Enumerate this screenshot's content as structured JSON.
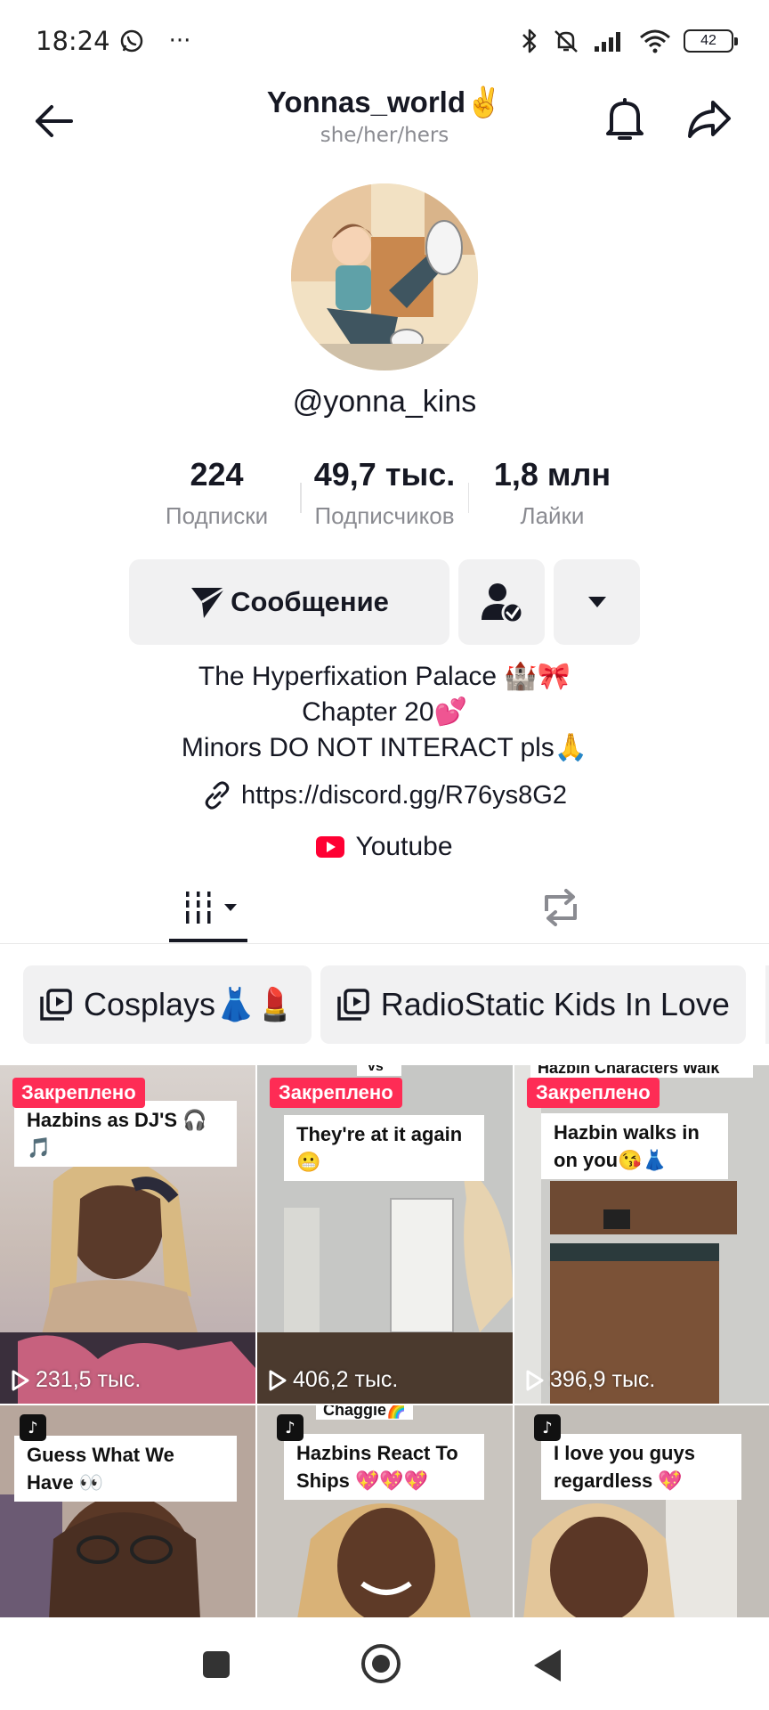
{
  "status_bar": {
    "time": "18:24",
    "more": "···",
    "battery": "42"
  },
  "header": {
    "title": "Yonnas_world✌️",
    "pronouns": "she/her/hers"
  },
  "profile": {
    "username": "@yonna_kins",
    "stats": [
      {
        "value": "224",
        "label": "Подписки"
      },
      {
        "value": "49,7 тыс.",
        "label": "Подписчиков"
      },
      {
        "value": "1,8 млн",
        "label": "Лайки"
      }
    ],
    "message_button": "Сообщение",
    "bio_lines": [
      "The Hyperfixation Palace 🏰🎀",
      "Chapter 20💕",
      "Minors DO NOT INTERACT pls🙏"
    ],
    "link": "https://discord.gg/R76ys8G2",
    "youtube": "Youtube"
  },
  "playlists": [
    {
      "label": "Cosplays👗💄"
    },
    {
      "label": "RadioStatic Kids In Love"
    }
  ],
  "videos": [
    {
      "pinned": "Закреплено",
      "caption": "Hazbins as DJ'S 🎧🎵",
      "views": "231,5 тыс.",
      "top_label": ""
    },
    {
      "pinned": "Закреплено",
      "caption": "They're at it again 😬",
      "views": "406,2 тыс.",
      "top_label": "vs"
    },
    {
      "pinned": "Закреплено",
      "caption": "Hazbin walks in on you😘👗",
      "views": "396,9 тыс.",
      "top_label": "Hazbin Characters Walk"
    },
    {
      "pinned": "",
      "caption": "Guess What We Have 👀",
      "views": "",
      "top_label": ""
    },
    {
      "pinned": "",
      "caption": "Hazbins React To Ships 💖💖💖",
      "views": "",
      "top_label": "Chaggie🌈"
    },
    {
      "pinned": "",
      "caption": "I love you guys regardless 💖",
      "views": "",
      "top_label": ""
    }
  ],
  "colors": {
    "pinned_bg": "#fe2c55",
    "button_bg": "#f1f1f2",
    "muted_text": "#8a8b91"
  }
}
